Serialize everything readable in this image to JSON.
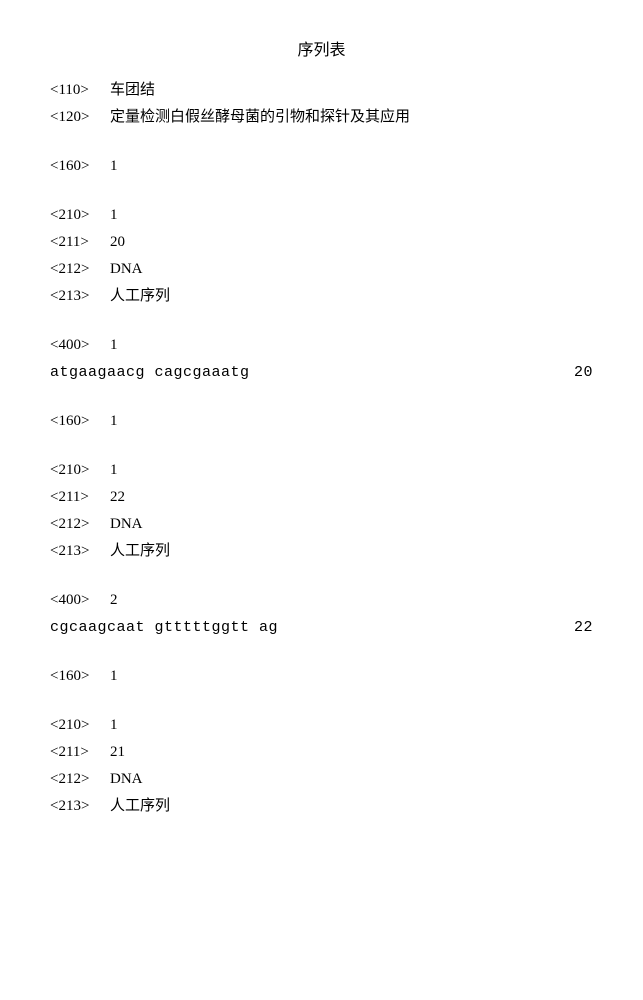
{
  "title": "序列表",
  "header": {
    "tag110": "<110>",
    "val110": "车团结",
    "tag120": "<120>",
    "val120": "定量检测白假丝酵母菌的引物和探针及其应用"
  },
  "blocks": [
    {
      "tag160": "<160>",
      "val160": "1",
      "tag210": "<210>",
      "val210": "1",
      "tag211": "<211>",
      "val211": "20",
      "tag212": "<212>",
      "val212": "DNA",
      "tag213": "<213>",
      "val213": "人工序列",
      "tag400": "<400>",
      "val400": "1",
      "seq": "atgaagaacg cagcgaaatg",
      "seqlen": "20"
    },
    {
      "tag160": "<160>",
      "val160": "1",
      "tag210": "<210>",
      "val210": "1",
      "tag211": "<211>",
      "val211": "22",
      "tag212": "<212>",
      "val212": "DNA",
      "tag213": "<213>",
      "val213": "人工序列",
      "tag400": "<400>",
      "val400": "2",
      "seq": "cgcaagcaat gtttttggtt ag",
      "seqlen": "22"
    },
    {
      "tag160": "<160>",
      "val160": "1",
      "tag210": "<210>",
      "val210": "1",
      "tag211": "<211>",
      "val211": "21",
      "tag212": "<212>",
      "val212": "DNA",
      "tag213": "<213>",
      "val213": "人工序列"
    }
  ]
}
